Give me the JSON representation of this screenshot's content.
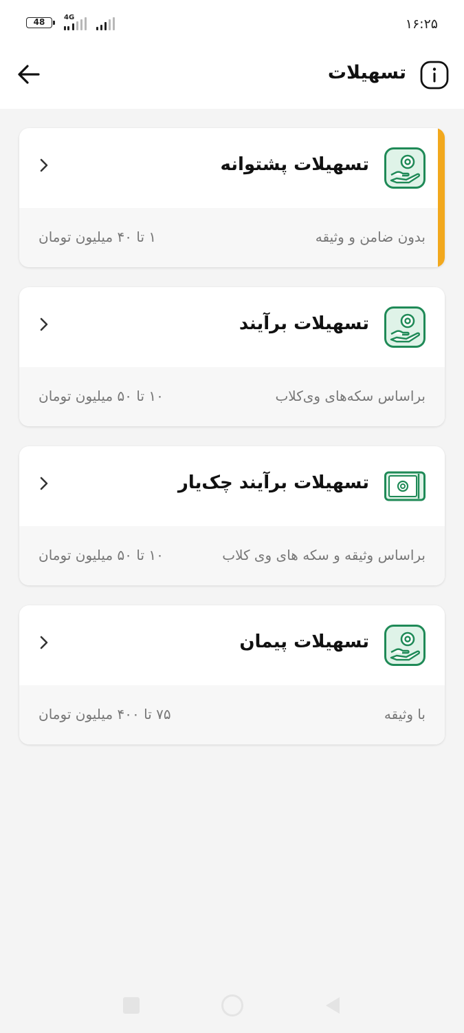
{
  "status_bar": {
    "battery": "48",
    "network": "4G",
    "time": "۱۶:۲۵"
  },
  "header": {
    "title": "تسهیلات",
    "back_icon": "arrow-left-icon",
    "info_icon": "info-icon"
  },
  "cards": [
    {
      "title": "تسهیلات پشتوانه",
      "description": "بدون ضامن و وثیقه",
      "range": "۱ تا ۴۰ میلیون تومان",
      "icon": "hand-coin-icon",
      "selected": true
    },
    {
      "title": "تسهیلات برآیند",
      "description": "براساس سکه‌های وی‌کلاب",
      "range": "۱۰ تا ۵۰ میلیون تومان",
      "icon": "hand-coin-icon",
      "selected": false
    },
    {
      "title": "تسهیلات برآیند چک‌یار",
      "description": "براساس وثیقه و سکه های وی کلاب",
      "range": "۱۰ تا ۵۰ میلیون تومان",
      "icon": "banknote-icon",
      "selected": false
    },
    {
      "title": "تسهیلات پیمان",
      "description": "با وثیقه",
      "range": "۷۵ تا ۴۰۰ میلیون تومان",
      "icon": "hand-coin-icon",
      "selected": false
    }
  ],
  "colors": {
    "accent": "#f2a81d",
    "icon_green": "#1f8a57",
    "icon_fill": "#dff3e8"
  }
}
